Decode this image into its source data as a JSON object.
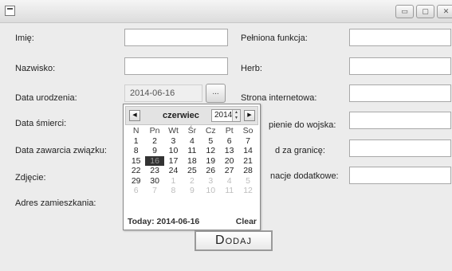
{
  "window": {
    "icon": "app-icon",
    "buttons": [
      {
        "name": "minimize",
        "glyph": "▭"
      },
      {
        "name": "maximize",
        "glyph": "▢"
      },
      {
        "name": "close",
        "glyph": "✕"
      }
    ]
  },
  "form": {
    "left_labels": [
      "Imię:",
      "Nazwisko:",
      "Data urodzenia:",
      "Data śmierci:",
      "Data zawarcia związku:",
      "Zdjęcie:",
      "Adres zamieszkania:"
    ],
    "right_labels": [
      "Pełniona funkcja:",
      "Herb:",
      "Strona internetowa:",
      "pienie do wojska:",
      "d za granicę:",
      "nacje dodatkowe:"
    ],
    "birth_date_value": "2014-06-16",
    "picker_button_label": "..."
  },
  "calendar": {
    "prev_glyph": "◀",
    "next_glyph": "▶",
    "month": "czerwiec",
    "year": "2014",
    "weekdays": [
      "N",
      "Pn",
      "Wt",
      "Śr",
      "Cz",
      "Pt",
      "So"
    ],
    "weeks": [
      [
        "1",
        "2",
        "3",
        "4",
        "5",
        "6",
        "7"
      ],
      [
        "8",
        "9",
        "10",
        "11",
        "12",
        "13",
        "14"
      ],
      [
        "15",
        "16",
        "17",
        "18",
        "19",
        "20",
        "21"
      ],
      [
        "22",
        "23",
        "24",
        "25",
        "26",
        "27",
        "28"
      ],
      [
        "29",
        "30",
        "1",
        "2",
        "3",
        "4",
        "5"
      ],
      [
        "6",
        "7",
        "8",
        "9",
        "10",
        "11",
        "12"
      ]
    ],
    "selected_day": "16",
    "today_label": "Today: 2014-06-16",
    "clear_label": "Clear"
  },
  "add_button_label": "Dodaj"
}
